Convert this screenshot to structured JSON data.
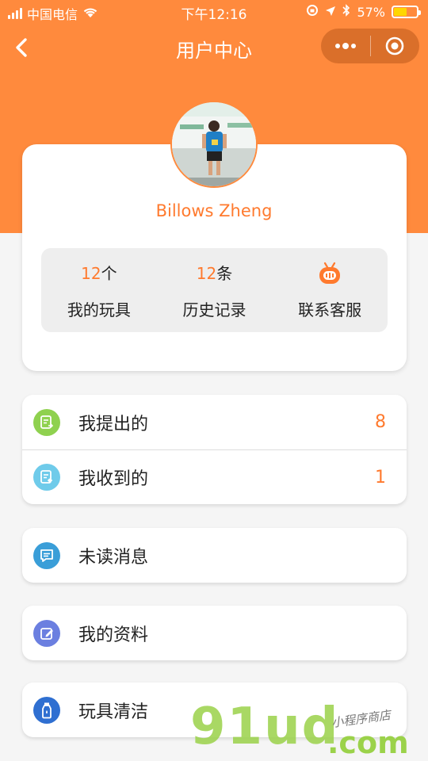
{
  "status_bar": {
    "carrier": "中国电信",
    "time": "下午12:16",
    "battery_percent": "57%",
    "battery_level": 0.57
  },
  "nav": {
    "title": "用户中心"
  },
  "profile": {
    "username": "Billows Zheng"
  },
  "stats": [
    {
      "count": "12",
      "unit": "个",
      "label": "我的玩具"
    },
    {
      "count": "12",
      "unit": "条",
      "label": "历史记录"
    },
    {
      "label": "联系客服",
      "icon": "customer-service-icon"
    }
  ],
  "menu_group1": [
    {
      "label": "我提出的",
      "count": "8",
      "icon": "submitted-icon",
      "icon_color": "#8fd14f"
    },
    {
      "label": "我收到的",
      "count": "1",
      "icon": "received-icon",
      "icon_color": "#6fcbea"
    }
  ],
  "menu_unread": {
    "label": "未读消息",
    "icon": "message-icon",
    "icon_color": "#3a9ed8"
  },
  "menu_profile": {
    "label": "我的资料",
    "icon": "edit-icon",
    "icon_color": "#6b7fe0"
  },
  "menu_clean": {
    "label": "玩具清洁",
    "icon": "bottle-icon",
    "icon_color": "#2f6fd1"
  },
  "watermark": {
    "main": "91ud",
    "domain": ".com",
    "sub": "小程序商店"
  },
  "colors": {
    "accent": "#ff8a3d",
    "highlight": "#ff7a2e"
  }
}
